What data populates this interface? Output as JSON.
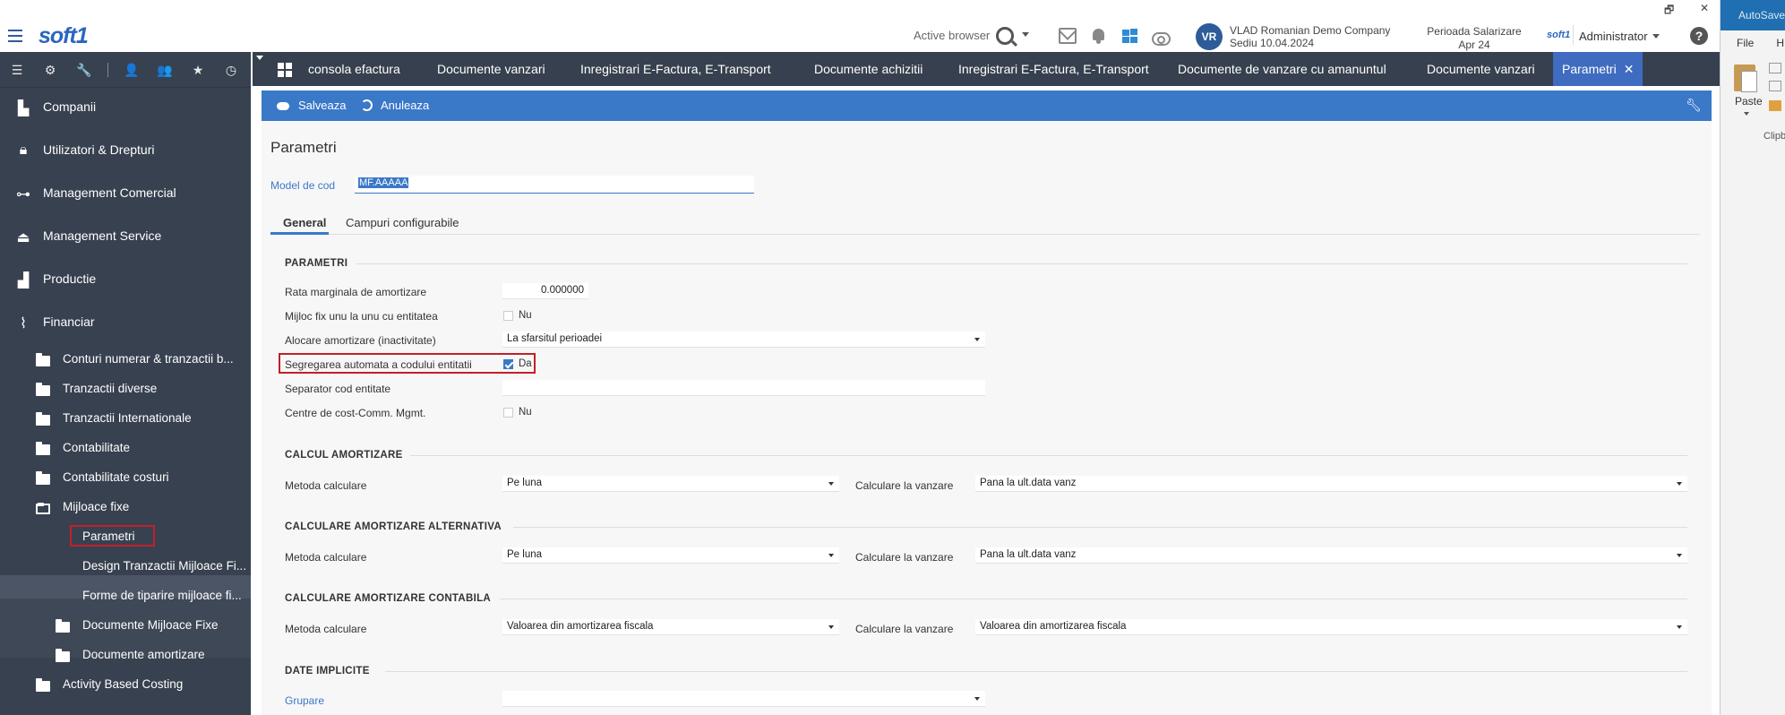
{
  "header": {
    "logo": "soft1",
    "active_browser": "Active browser",
    "company_avatar": "VR",
    "company_name": "VLAD Romanian Demo Company",
    "company_sub": "Sediu 10.04.2024",
    "period_line1": "Perioada Salarizare",
    "period_line2": "Apr 24",
    "user_logo": "soft1",
    "user_name": "Administrator",
    "help": "?",
    "win_restore": "🗗",
    "win_close": "✕"
  },
  "excel": {
    "autosave": "AutoSave",
    "menu_file": "File",
    "menu_home": "H",
    "paste": "Paste",
    "clipboard": "Clipb"
  },
  "sidebar": {
    "items": [
      {
        "label": "Companii",
        "icon": "building-icon"
      },
      {
        "label": "Utilizatori & Drepturi",
        "icon": "lock-icon"
      },
      {
        "label": "Management Comercial",
        "icon": "sitemap-icon"
      },
      {
        "label": "Management Service",
        "icon": "service-bell-icon"
      },
      {
        "label": "Productie",
        "icon": "factory-icon"
      },
      {
        "label": "Financiar",
        "icon": "chart-line-icon"
      }
    ],
    "sub_items": [
      {
        "label": "Conturi numerar & tranzactii b..."
      },
      {
        "label": "Tranzactii diverse"
      },
      {
        "label": "Tranzactii Internationale"
      },
      {
        "label": "Contabilitate"
      },
      {
        "label": "Contabilitate costuri"
      },
      {
        "label": "Mijloace fixe"
      }
    ],
    "leaf_items": [
      {
        "label": "Parametri"
      },
      {
        "label": "Design Tranzactii Mijloace Fi..."
      },
      {
        "label": "Forme de tiparire mijloace fi..."
      }
    ],
    "sub_items2": [
      {
        "label": "Documente Mijloace Fixe"
      },
      {
        "label": "Documente amortizare"
      }
    ],
    "bottom_item": {
      "label": "Activity Based Costing"
    }
  },
  "tabs": [
    {
      "label": "consola efactura"
    },
    {
      "label": "Documente vanzari"
    },
    {
      "label": "Inregistrari E-Factura, E-Transport"
    },
    {
      "label": "Documente achizitii"
    },
    {
      "label": "Inregistrari E-Factura, E-Transport"
    },
    {
      "label": "Documente de vanzare cu amanuntul"
    },
    {
      "label": "Documente vanzari"
    },
    {
      "label": "Parametri"
    }
  ],
  "tab_close": "✕",
  "toolbar": {
    "save": "Salveaza",
    "cancel": "Anuleaza"
  },
  "form": {
    "title": "Parametri",
    "model_label": "Model de cod",
    "model_value": "MF.AAAAA",
    "subtab_general": "General",
    "subtab_custom": "Campuri configurabile",
    "sections": {
      "parametri": "PARAMETRI",
      "calcul": "CALCUL AMORTIZARE",
      "alternativa": "CALCULARE AMORTIZARE ALTERNATIVA",
      "contabila": "CALCULARE AMORTIZARE CONTABILA",
      "implicite": "DATE IMPLICITE"
    },
    "fields": {
      "rata_label": "Rata marginala de amortizare",
      "rata_value": "0.000000",
      "mijloc_label": "Mijloc fix unu la unu cu entitatea",
      "mijloc_value": "Nu",
      "alocare_label": "Alocare amortizare (inactivitate)",
      "alocare_value": "La sfarsitul perioadei",
      "segregare_label": "Segregarea automata a codului entitatii",
      "segregare_value": "Da",
      "separator_label": "Separator cod entitate",
      "separator_value": "",
      "centre_label": "Centre de cost-Comm. Mgmt.",
      "centre_value": "Nu",
      "metoda_label": "Metoda calculare",
      "vanzare_label": "Calculare la vanzare",
      "calc_metoda": "Pe luna",
      "calc_vanzare": "Pana la ult.data vanz",
      "alt_metoda": "Pe luna",
      "alt_vanzare": "Pana la ult.data vanz",
      "cont_metoda": "Valoarea din amortizarea fiscala",
      "cont_vanzare": "Valoarea din amortizarea fiscala",
      "grupare_label": "Grupare",
      "grupare_value": ""
    }
  },
  "colors": {
    "accent": "#3a78c8",
    "sidebar": "#38414f",
    "highlight": "#c0202a"
  }
}
